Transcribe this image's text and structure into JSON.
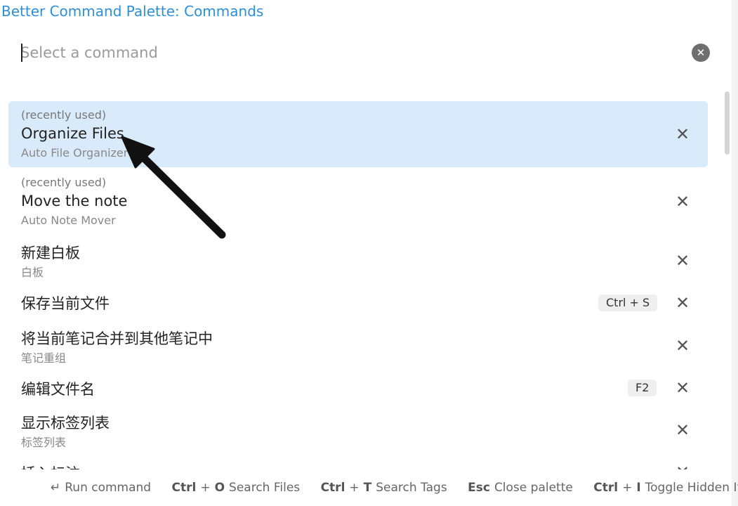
{
  "title": "Better Command Palette: Commands",
  "search": {
    "placeholder": "Select a command",
    "value": ""
  },
  "icons": {
    "clear": "close-circle-icon",
    "remove": "close-icon",
    "enter": "enter-icon"
  },
  "items": [
    {
      "recent": "(recently used)",
      "name": "Organize Files",
      "plugin": "Auto File Organizer",
      "hotkey": "",
      "selected": true
    },
    {
      "recent": "(recently used)",
      "name": "Move the note",
      "plugin": "Auto Note Mover",
      "hotkey": ""
    },
    {
      "recent": "",
      "name": "新建白板",
      "plugin": "白板",
      "hotkey": ""
    },
    {
      "recent": "",
      "name": "保存当前文件",
      "plugin": "",
      "hotkey": "Ctrl + S"
    },
    {
      "recent": "",
      "name": "将当前笔记合并到其他笔记中",
      "plugin": "笔记重组",
      "hotkey": ""
    },
    {
      "recent": "",
      "name": "编辑文件名",
      "plugin": "",
      "hotkey": "F2"
    },
    {
      "recent": "",
      "name": "显示标签列表",
      "plugin": "标签列表",
      "hotkey": ""
    },
    {
      "recent": "",
      "name": "插入标注",
      "plugin": "",
      "hotkey": ""
    }
  ],
  "footer": {
    "run_key": "↵",
    "run_label": "Run command",
    "files_key_1": "Ctrl",
    "files_plus": "+",
    "files_key_2": "O",
    "files_label": "Search Files",
    "tags_key_1": "Ctrl",
    "tags_plus": "+",
    "tags_key_2": "T",
    "tags_label": "Search Tags",
    "close_key": "Esc",
    "close_label": "Close palette",
    "hidden_key_1": "Ctrl",
    "hidden_plus": "+",
    "hidden_key_2": "I",
    "hidden_label": "Toggle Hidden Items"
  }
}
